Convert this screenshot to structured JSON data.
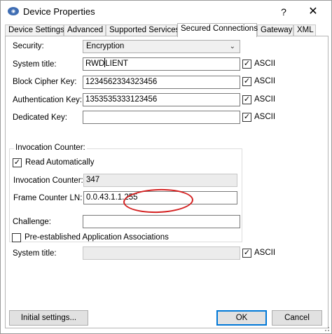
{
  "window": {
    "title": "Device Properties",
    "help_label": "?",
    "close_label": "✕"
  },
  "tabs": [
    {
      "label": "Device Settings",
      "active": false
    },
    {
      "label": "Advanced",
      "active": false
    },
    {
      "label": "Supported Services",
      "active": false
    },
    {
      "label": "Secured Connections",
      "active": true
    },
    {
      "label": "Gateway",
      "active": false
    },
    {
      "label": "XML",
      "active": false
    }
  ],
  "security": {
    "label": "Security:",
    "value": "Encryption"
  },
  "system_title": {
    "label": "System title:",
    "value_before_caret": "RWD",
    "value_after_caret": "LIENT",
    "ascii_label": "ASCII",
    "ascii_checked": true
  },
  "block_cipher_key": {
    "label": "Block Cipher Key:",
    "value": "1234562334323456",
    "ascii_label": "ASCII",
    "ascii_checked": true
  },
  "authentication_key": {
    "label": "Authentication Key:",
    "value": "1353535333123456",
    "ascii_label": "ASCII",
    "ascii_checked": true
  },
  "dedicated_key": {
    "label": "Dedicated Key:",
    "value": "",
    "ascii_label": "ASCII",
    "ascii_checked": true
  },
  "invocation_group": {
    "title": "Invocation Counter:",
    "read_automatically_label": "Read Automatically",
    "read_automatically_checked": true,
    "counter_label": "Invocation Counter:",
    "counter_value": "347",
    "frame_counter_label": "Frame Counter LN:",
    "frame_counter_value": "0.0.43.1.1.255"
  },
  "challenge": {
    "label": "Challenge:",
    "value": ""
  },
  "pre_established": {
    "label": "Pre-established Application Associations",
    "checked": false
  },
  "system_title_2": {
    "label": "System title:",
    "value": "",
    "ascii_label": "ASCII",
    "ascii_checked": true
  },
  "buttons": {
    "initial_settings": "Initial settings...",
    "ok": "OK",
    "cancel": "Cancel"
  },
  "colors": {
    "annotation_circle": "#d42020",
    "default_button_border": "#0078d7"
  }
}
